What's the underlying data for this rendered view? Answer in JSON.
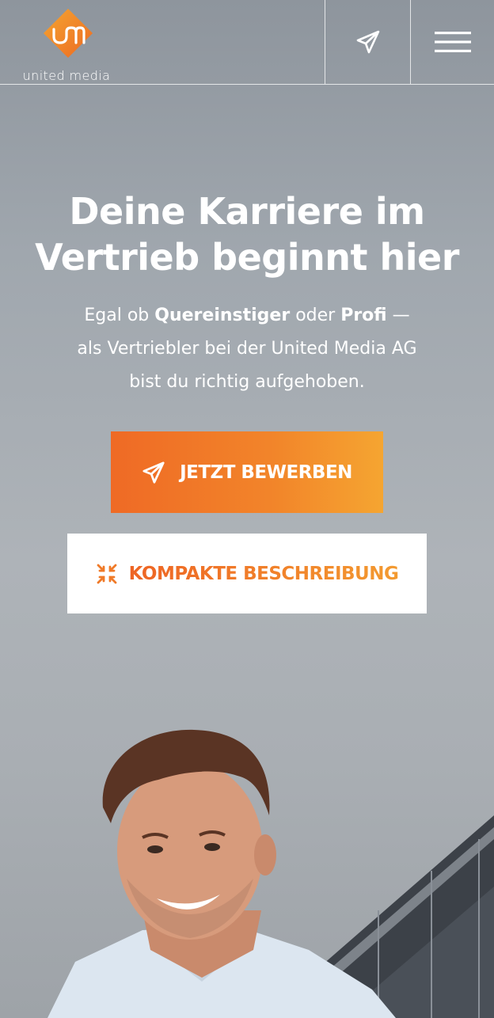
{
  "brand": {
    "name": "united media",
    "accent": "#f07a28",
    "accent_light": "#f5a531"
  },
  "header": {
    "send_icon": "paper-plane-icon",
    "menu_icon": "hamburger-menu-icon"
  },
  "hero": {
    "headline_line1": "Deine Karriere im",
    "headline_line2": "Vertrieb beginnt hier",
    "sub_part1": "Egal ob ",
    "sub_bold1": "Quereinstiger",
    "sub_part2": " oder ",
    "sub_bold2": "Profi",
    "sub_part3": " —",
    "sub_line2": "als Vertriebler bei der United Media AG",
    "sub_line3": "bist du richtig aufgehoben."
  },
  "buttons": {
    "apply_label": "JETZT BEWERBEN",
    "apply_icon": "paper-plane-icon",
    "compact_label": "KOMPAKTE BESCHREIBUNG",
    "compact_icon": "collapse-arrows-icon"
  }
}
